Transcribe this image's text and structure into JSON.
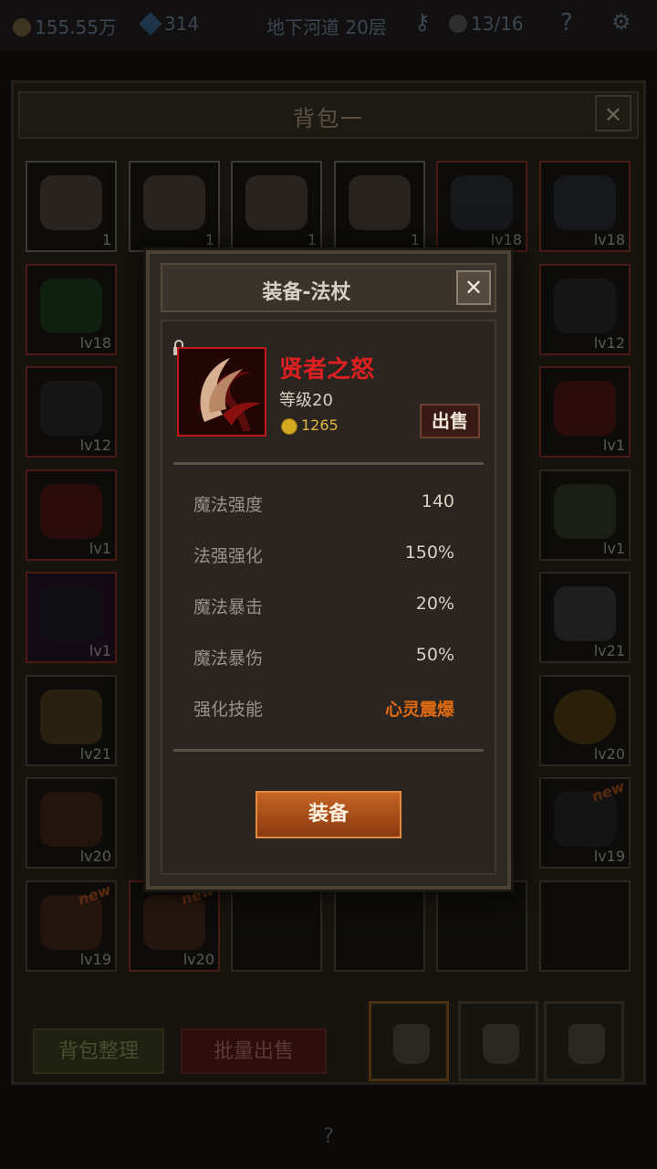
{
  "topbar": {
    "gold": "155.55万",
    "gems": "314",
    "location": "地下河道 20层",
    "key_icon": "key-icon",
    "skull_count": "13/16",
    "help": "?"
  },
  "bag": {
    "title": "背包一",
    "close": "✕",
    "sort_label": "背包整理",
    "batch_sell_label": "批量出售",
    "help": "?",
    "slots": [
      {
        "item": "cake",
        "level": "1"
      },
      {
        "item": "cake",
        "level": "1"
      },
      {
        "item": "cake",
        "level": "1"
      },
      {
        "item": "cake",
        "level": "1"
      },
      {
        "item": "bow",
        "level": "lv18"
      },
      {
        "item": "bow",
        "level": "lv18"
      },
      {
        "item": "cloak",
        "level": "lv18"
      },
      {
        "item": "necklace",
        "level": "lv12"
      },
      {
        "item": "necklace",
        "level": "lv12"
      },
      {
        "item": "staff",
        "level": "lv1"
      },
      {
        "item": "staff",
        "level": "lv1"
      },
      {
        "item": "boots",
        "level": "lv1"
      },
      {
        "item": "armor",
        "level": "lv1"
      },
      {
        "item": "helmet",
        "level": "lv21"
      },
      {
        "item": "shield",
        "level": "lv21"
      },
      {
        "item": "ring",
        "level": "lv20"
      },
      {
        "item": "boots",
        "level": "lv20"
      },
      {
        "item": "bow",
        "level": "lv19",
        "badge": "new"
      },
      {
        "item": "boots",
        "level": "lv19",
        "badge": "new"
      },
      {
        "item": "staff",
        "level": "lv20",
        "badge": "new"
      }
    ]
  },
  "modal": {
    "title": "装备-法杖",
    "close": "✕",
    "item_name": "贤者之怒",
    "item_level": "等级20",
    "price": "1265",
    "sell_label": "出售",
    "stats": [
      {
        "label": "魔法强度",
        "value": "140"
      },
      {
        "label": "法强强化",
        "value": "150%"
      },
      {
        "label": "魔法暴击",
        "value": "20%"
      },
      {
        "label": "魔法暴伤",
        "value": "50%"
      },
      {
        "label": "强化技能",
        "value": "心灵震爆"
      }
    ],
    "equip_label": "装备"
  },
  "colors": {
    "item_name": "#e02020",
    "skill": "#e06a10",
    "equip_button": "#c66424"
  }
}
